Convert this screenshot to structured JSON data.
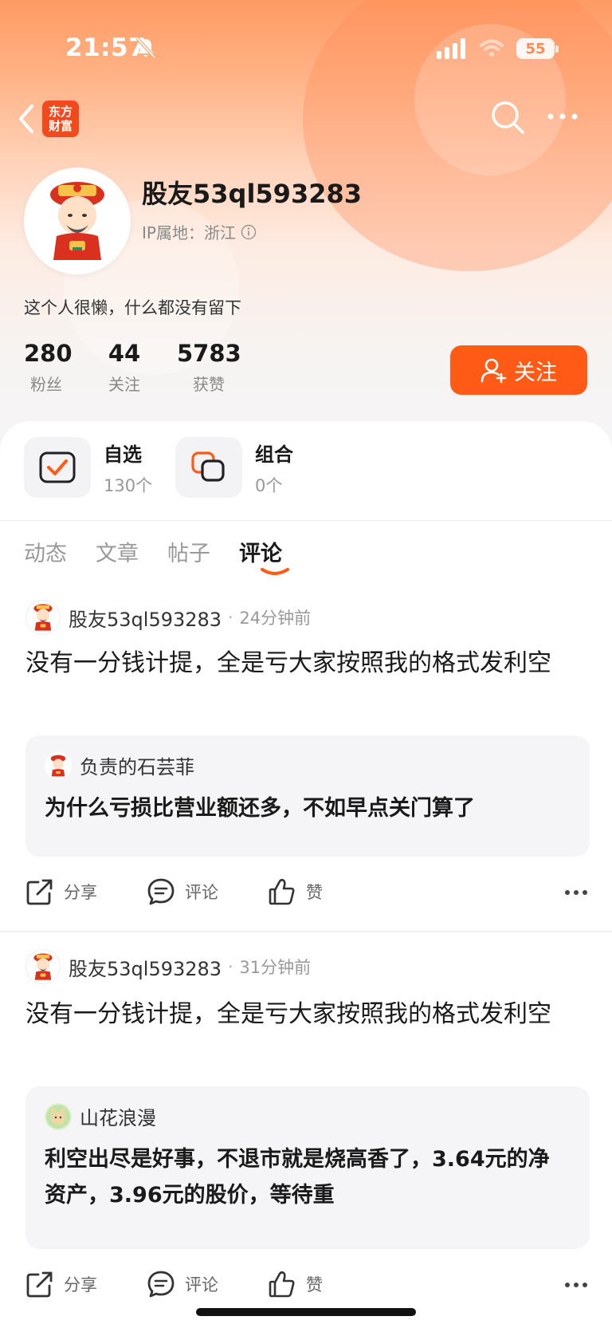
{
  "status_bar": {
    "time": "21:57",
    "battery": "55"
  },
  "nav": {
    "app_logo_text": "东方财富"
  },
  "profile": {
    "username": "股友53ql593283",
    "ip_location": "IP属地：浙江",
    "bio": "这个人很懒，什么都没有留下",
    "stats": [
      {
        "value": "280",
        "label": "粉丝"
      },
      {
        "value": "44",
        "label": "关注"
      },
      {
        "value": "5783",
        "label": "获赞"
      }
    ],
    "follow_label": "关注"
  },
  "shortcuts": [
    {
      "title": "自选",
      "count": "130个",
      "icon": "checkmark-square-icon"
    },
    {
      "title": "组合",
      "count": "0个",
      "icon": "overlapping-squares-icon"
    }
  ],
  "tabs": [
    {
      "label": "动态",
      "active": false
    },
    {
      "label": "文章",
      "active": false
    },
    {
      "label": "帖子",
      "active": false
    },
    {
      "label": "评论",
      "active": true
    }
  ],
  "posts": [
    {
      "author": "股友53ql593283",
      "dot": "·",
      "time": "24分钟前",
      "body": "没有一分钱计提，全是亏大家按照我的格式发利空",
      "quote": {
        "author": "负责的石芸菲",
        "text": "为什么亏损比营业额还多，不如早点关门算了"
      },
      "actions": {
        "share": "分享",
        "comment": "评论",
        "like": "赞"
      }
    },
    {
      "author": "股友53ql593283",
      "dot": "·",
      "time": "31分钟前",
      "body": "没有一分钱计提，全是亏大家按照我的格式发利空",
      "quote": {
        "author": "山花浪漫",
        "text": "利空出尽是好事，不退市就是烧高香了，3.64元的净资产，3.96元的股价，等待重"
      },
      "actions": {
        "share": "分享",
        "comment": "评论",
        "like": "赞"
      }
    }
  ],
  "colors": {
    "accent": "#ff5a16",
    "header_gradient_top": "#ff9a63"
  }
}
